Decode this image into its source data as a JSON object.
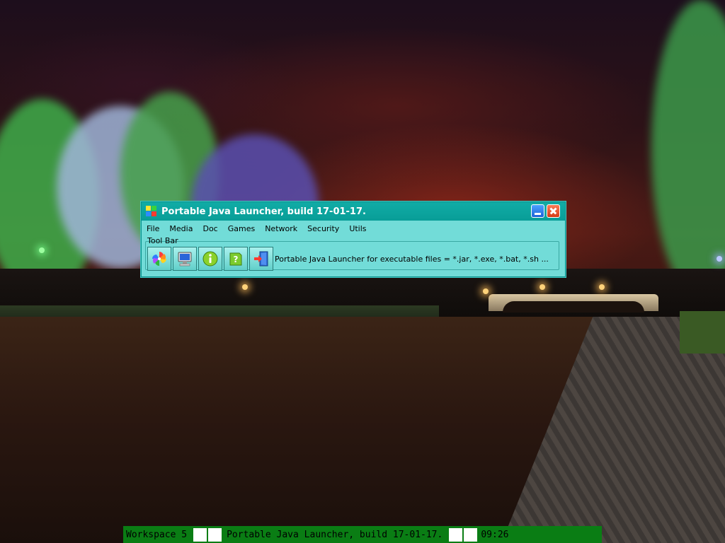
{
  "window": {
    "title": "Portable Java Launcher, build 17-01-17.",
    "app_icon": "app-grid-icon",
    "controls": {
      "minimize": "minimize-icon",
      "close": "close-icon"
    },
    "menu": [
      "File",
      "Media",
      "Doc",
      "Games",
      "Network",
      "Security",
      "Utils"
    ],
    "toolbar": {
      "caption": "Tool Bar",
      "buttons": [
        {
          "name": "pinwheel-icon"
        },
        {
          "name": "computer-icon"
        },
        {
          "name": "info-icon"
        },
        {
          "name": "help-icon"
        },
        {
          "name": "exit-door-icon"
        }
      ],
      "description": "Portable Java Launcher for executable files = *.jar, *.exe, *.bat, *.sh ..."
    },
    "colors": {
      "titlebar": "#089d97",
      "body": "#72dcd8"
    }
  },
  "taskbar": {
    "workspace": "Workspace 5",
    "active_window": "Portable Java Launcher, build 17-01-17.",
    "clock": "09:26",
    "color": "#0a7d14"
  }
}
